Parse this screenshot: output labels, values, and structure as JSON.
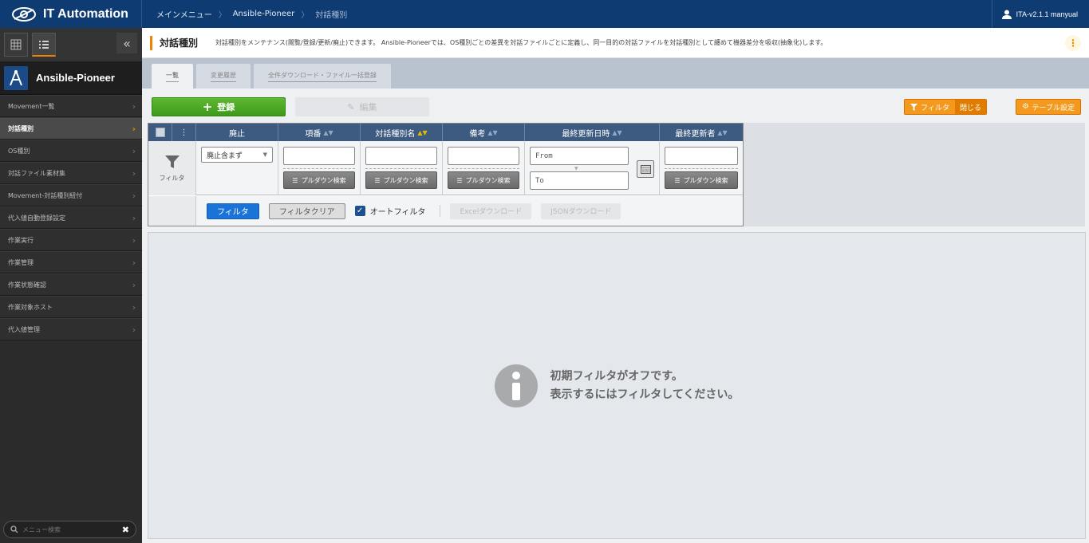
{
  "app": {
    "title": "IT Automation"
  },
  "breadcrumb": [
    "メインメニュー",
    "Ansible-Pioneer",
    "対話種別"
  ],
  "user": {
    "label": "ITA-v2.1.1 manyual"
  },
  "sidebar": {
    "title": "Ansible-Pioneer",
    "items": [
      {
        "label": "Movement一覧"
      },
      {
        "label": "対話種別"
      },
      {
        "label": "OS種別"
      },
      {
        "label": "対話ファイル素材集"
      },
      {
        "label": "Movement-対話種別紐付"
      },
      {
        "label": "代入値自動登録設定"
      },
      {
        "label": "作業実行"
      },
      {
        "label": "作業管理"
      },
      {
        "label": "作業状態確認"
      },
      {
        "label": "作業対象ホスト"
      },
      {
        "label": "代入値管理"
      }
    ],
    "search_placeholder": "メニュー検索"
  },
  "page": {
    "title": "対話種別",
    "description": "対話種別をメンテナンス(閲覧/登録/更新/廃止)できます。 Ansible-Pioneerでは、OS種別ごとの差異を対話ファイルごとに定義し、同一目的の対話ファイルを対話種別として纏めて機器差分を吸収(抽象化)します。"
  },
  "tabs": [
    {
      "label": "一覧"
    },
    {
      "label": "変更履歴"
    },
    {
      "label": "全件ダウンロード・ファイル一括登録"
    }
  ],
  "actions": {
    "register": "登録",
    "edit": "編集",
    "filter": "フィルタ",
    "filter_close": "閉じる",
    "table_setting": "テーブル設定"
  },
  "table": {
    "columns": [
      "廃止",
      "項番",
      "対話種別名",
      "備考",
      "最終更新日時",
      "最終更新者"
    ],
    "filter_label": "フィルタ",
    "discard_select": "廃止含まず",
    "pulldown_label": "プルダウン検索",
    "from_placeholder": "From",
    "to_placeholder": "To"
  },
  "filter_footer": {
    "filter_button": "フィルタ",
    "clear_button": "フィルタクリア",
    "auto_filter": "オートフィルタ",
    "excel_download": "Excelダウンロード",
    "json_download": "JSONダウンロード"
  },
  "message": {
    "line1": "初期フィルタがオフです。",
    "line2": "表示するにはフィルタしてください。"
  },
  "colors": {
    "topbar": "#0f3b73",
    "accent": "#f08400",
    "register_green": "#4aa523",
    "filter_blue": "#1a73d9",
    "table_header": "#3d5a80"
  }
}
